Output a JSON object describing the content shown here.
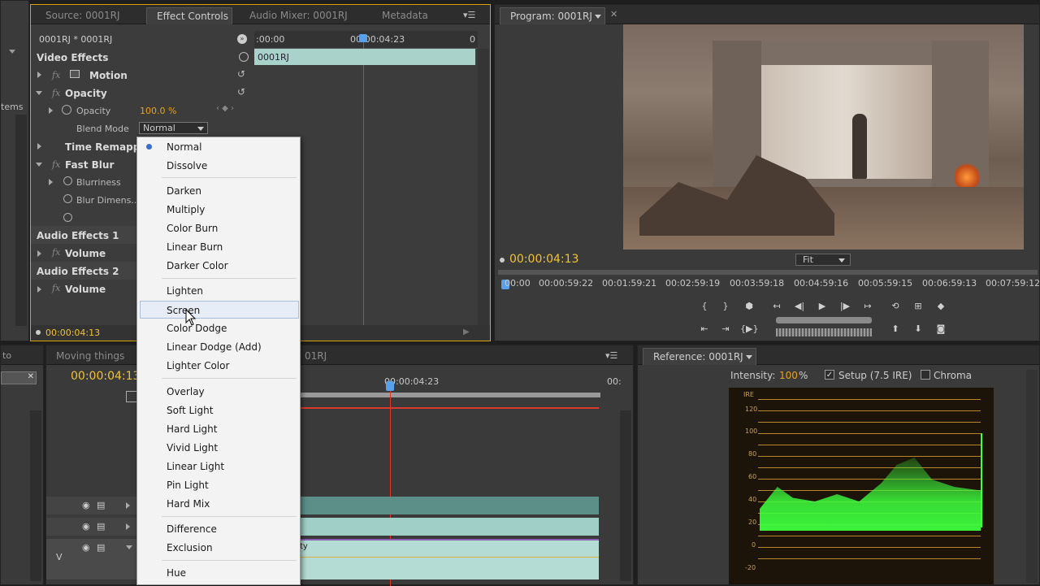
{
  "effect_controls": {
    "tabs": [
      "Source: 0001RJ",
      "Effect Controls",
      "Audio Mixer: 0001RJ",
      "Metadata"
    ],
    "clip_label": "0001RJ * 0001RJ",
    "ruler_start": ":00:00",
    "ruler_mid": "00:00:04:23",
    "ruler_end": "0",
    "clip_bar": "0001RJ",
    "video_effects": "Video Effects",
    "motion": "Motion",
    "opacity_group": "Opacity",
    "opacity_param": "Opacity",
    "opacity_value": "100.0 %",
    "blend_mode_label": "Blend Mode",
    "blend_mode_value": "Normal",
    "time_remapping": "Time Remappin",
    "fast_blur": "Fast Blur",
    "blurriness": "Blurriness",
    "blur_dimensions": "Blur Dimens...",
    "audio_effects_1": "Audio Effects 1",
    "volume_1": "Volume",
    "audio_effects_2": "Audio Effects 2",
    "volume_2": "Volume",
    "timecode": "00:00:04:13",
    "fx_symbol": "fx"
  },
  "blend_menu": {
    "groups": [
      [
        "Normal",
        "Dissolve"
      ],
      [
        "Darken",
        "Multiply",
        "Color Burn",
        "Linear Burn",
        "Darker Color"
      ],
      [
        "Lighten",
        "Screen",
        "Color Dodge",
        "Linear Dodge (Add)",
        "Lighter Color"
      ],
      [
        "Overlay",
        "Soft Light",
        "Hard Light",
        "Vivid Light",
        "Linear Light",
        "Pin Light",
        "Hard Mix"
      ],
      [
        "Difference",
        "Exclusion"
      ],
      [
        "Hue"
      ]
    ],
    "selected": "Normal",
    "hovered": "Screen"
  },
  "program": {
    "tab": "Program: 0001RJ",
    "timecode": "00:00:04:13",
    "fit": "Fit",
    "ruler": [
      "00:00",
      "00:00:59:22",
      "00:01:59:21",
      "00:02:59:19",
      "00:03:59:18",
      "00:04:59:16",
      "00:05:59:15",
      "00:06:59:13",
      "00:07:59:12"
    ]
  },
  "left_panel": {
    "text1": "tems",
    "text2": "to"
  },
  "timeline": {
    "tab": "Moving things",
    "tab2": "01RJ",
    "timecode": "00:00:04:13",
    "ruler_mid": "00:00:04:23",
    "ruler_end": "00:",
    "track_v": "V",
    "track_label": "ty"
  },
  "reference": {
    "tab": "Reference: 0001RJ",
    "intensity_label": "Intensity:",
    "intensity_value": "100",
    "intensity_unit": "%",
    "setup_label": "Setup (7.5 IRE)",
    "chroma_label": "Chroma",
    "ire_label": "IRE",
    "scale": [
      "120",
      "100",
      "80",
      "60",
      "40",
      "20",
      "0",
      "-20"
    ]
  },
  "colors": {
    "accent_orange": "#e8a317",
    "timecode_yellow": "#f2c230",
    "playhead_red": "#d93a2b",
    "waveform_green": "#3dff3d",
    "clip_teal": "#9fcfc6"
  }
}
